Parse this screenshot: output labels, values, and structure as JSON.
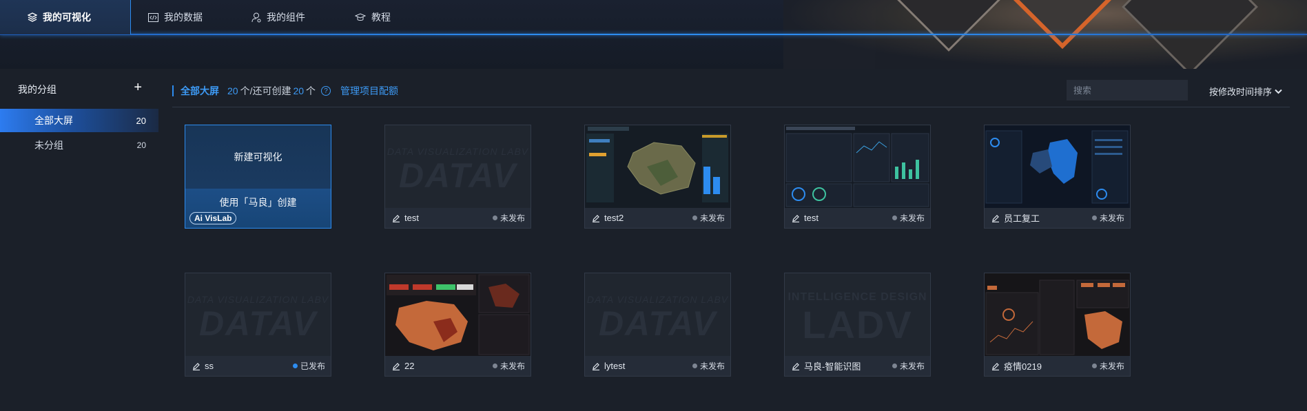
{
  "nav": {
    "items": [
      {
        "label": "我的可视化",
        "active": true
      },
      {
        "label": "我的数据"
      },
      {
        "label": "我的组件"
      },
      {
        "label": "教程"
      }
    ]
  },
  "sidebar": {
    "title": "我的分组",
    "add_icon": "plus-icon",
    "items": [
      {
        "label": "全部大屏",
        "count": "20",
        "active": true
      },
      {
        "label": "未分组",
        "count": "20"
      }
    ]
  },
  "toolbar": {
    "crumb_label": "全部大屏",
    "count": "20",
    "count_suffix": "个/还可创建",
    "remain": "20",
    "remain_suffix": "个",
    "manage_link": "管理项目配额",
    "search_placeholder": "搜索",
    "sort_label": "按修改时间排序"
  },
  "new_card": {
    "create_label": "新建可视化",
    "ai_label": "使用「马良」创建",
    "ai_logo": "Ai VisLab"
  },
  "watermark": {
    "datav_small": "DATA VISUALIZATION LABV",
    "datav_big": "DATAV",
    "ladv_small": "INTELLIGENCE DESIGN",
    "ladv_big": "LADV"
  },
  "cards": [
    {
      "name": "test",
      "status": "未发布",
      "published": false,
      "thumb": "datav"
    },
    {
      "name": "test2",
      "status": "未发布",
      "published": false,
      "thumb": "map"
    },
    {
      "name": "test",
      "status": "未发布",
      "published": false,
      "thumb": "dash"
    },
    {
      "name": "员工复工",
      "status": "未发布",
      "published": false,
      "thumb": "bluemap"
    },
    {
      "name": "ss",
      "status": "已发布",
      "published": true,
      "thumb": "datav"
    },
    {
      "name": "22",
      "status": "未发布",
      "published": false,
      "thumb": "redmap"
    },
    {
      "name": "lytest",
      "status": "未发布",
      "published": false,
      "thumb": "datav"
    },
    {
      "name": "马良-智能识图",
      "status": "未发布",
      "published": false,
      "thumb": "ladv"
    },
    {
      "name": "疫情0219",
      "status": "未发布",
      "published": false,
      "thumb": "table"
    }
  ],
  "colors": {
    "accent": "#2d8cf0",
    "bg": "#1b2029",
    "published": "#2d8cf0",
    "unpublished": "#7d8592"
  }
}
